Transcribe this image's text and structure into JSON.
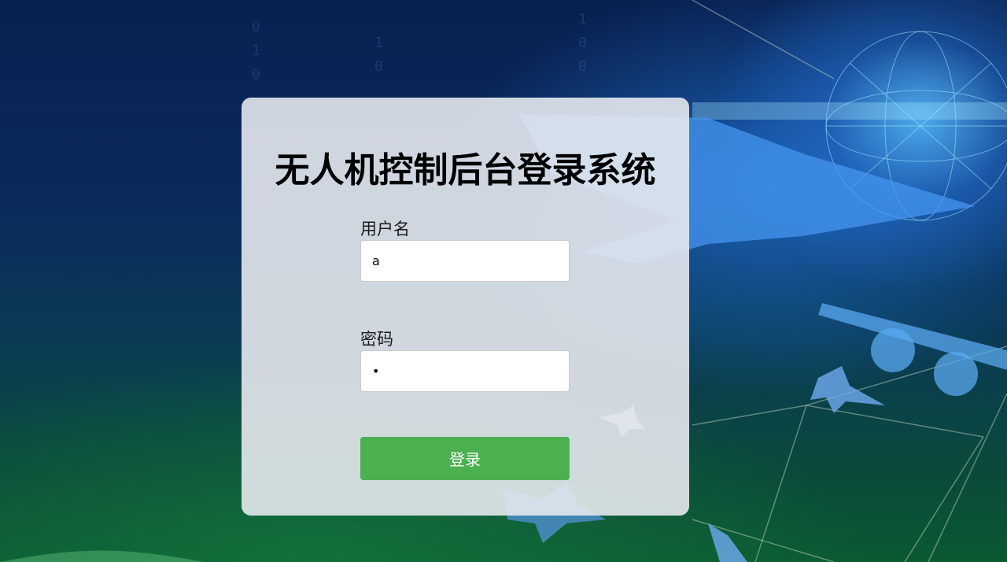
{
  "login": {
    "title": "无人机控制后台登录系统",
    "username_label": "用户名",
    "username_value": "a",
    "password_label": "密码",
    "password_value": "a",
    "submit_label": "登录"
  },
  "colors": {
    "button": "#4caf50",
    "card_bg": "#e6e9ee",
    "title_text": "#000000"
  }
}
